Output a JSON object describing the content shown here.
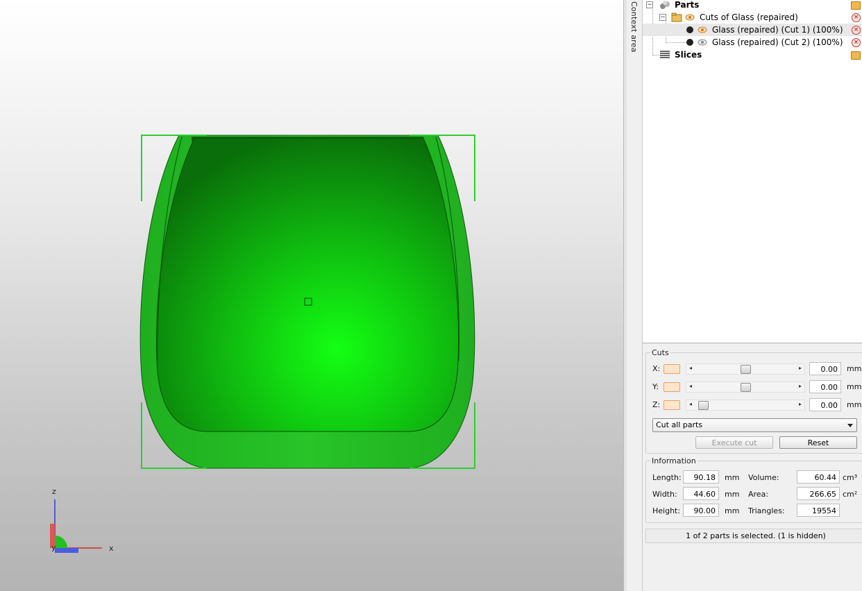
{
  "context_area": {
    "label": "Context area"
  },
  "tree": {
    "items": [
      {
        "label": "Parts"
      },
      {
        "label": "Cuts of Glass (repaired)"
      },
      {
        "label": "Glass (repaired) (Cut 1) (100%)"
      },
      {
        "label": "Glass (repaired) (Cut 2) (100%)"
      },
      {
        "label": "Slices"
      }
    ]
  },
  "cuts": {
    "title": "Cuts",
    "axes": [
      {
        "label": "X:",
        "value": "0.00",
        "unit": "mm"
      },
      {
        "label": "Y:",
        "value": "0.00",
        "unit": "mm"
      },
      {
        "label": "Z:",
        "value": "0.00",
        "unit": "mm"
      }
    ],
    "mode": "Cut all parts",
    "execute_label": "Execute cut",
    "reset_label": "Reset"
  },
  "info": {
    "title": "Information",
    "length_label": "Length:",
    "length_value": "90.18",
    "length_unit": "mm",
    "width_label": "Width:",
    "width_value": "44.60",
    "width_unit": "mm",
    "height_label": "Height:",
    "height_value": "90.00",
    "height_unit": "mm",
    "volume_label": "Volume:",
    "volume_value": "60.44",
    "volume_unit": "cm³",
    "area_label": "Area:",
    "area_value": "266.65",
    "area_unit": "cm²",
    "triangles_label": "Triangles:",
    "triangles_value": "19554"
  },
  "status": "1 of 2 parts is selected. (1 is hidden)",
  "axis_gizmo": {
    "z": "z",
    "x": "x",
    "y": "y"
  },
  "colors": {
    "model": "#22b61e",
    "selection": "#2ecc2e"
  },
  "icons": {
    "parts": "parts-icon",
    "folder": "folder-icon",
    "eye": "eye-icon",
    "remove": "remove-icon",
    "slices": "slices-icon",
    "bullet": "bullet-icon"
  }
}
